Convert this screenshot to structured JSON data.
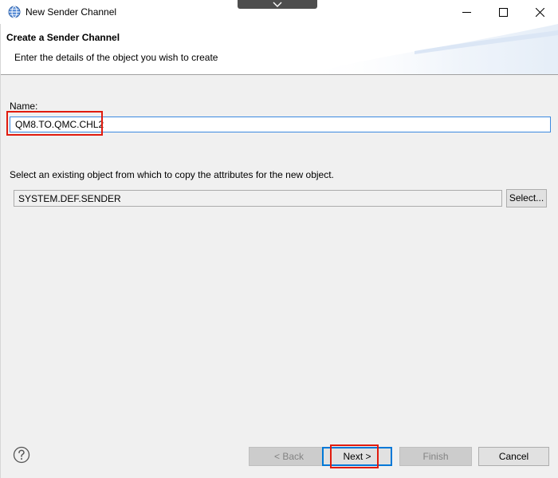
{
  "window": {
    "title": "New Sender Channel",
    "app_icon": "globe-icon",
    "controls": [
      "minimize-icon",
      "maximize-icon",
      "close-icon"
    ],
    "top_tab_icon": "chevron-down-icon"
  },
  "banner": {
    "title": "Create a Sender Channel",
    "description": "Enter the details of the object you wish to create"
  },
  "form": {
    "name_label": "Name:",
    "name_value": "QM8.TO.QMC.CHL2",
    "copy_label": "Select an existing object from which to copy the attributes for the new object.",
    "copy_value": "SYSTEM.DEF.SENDER",
    "select_button": "Select..."
  },
  "footer": {
    "help_icon": "help-icon",
    "back_label": "< Back",
    "next_label": "Next >",
    "finish_label": "Finish",
    "cancel_label": "Cancel"
  },
  "colors": {
    "highlight": "#e11b0e",
    "focus_border": "#3c8ae0",
    "default_button_border": "#0078d7",
    "dialog_background": "#f0f0f0"
  }
}
